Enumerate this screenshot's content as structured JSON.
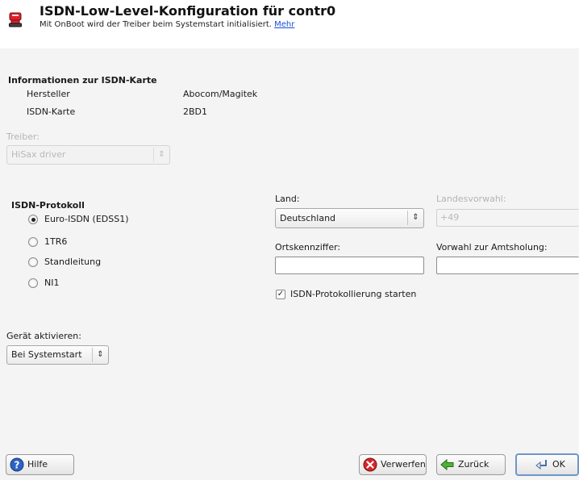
{
  "header": {
    "title": "ISDN-Low-Level-Konfiguration für contr0",
    "subtitle": "Mit OnBoot wird der Treiber beim Systemstart initialisiert.",
    "more_link": "Mehr",
    "icon": "isdn-card-icon"
  },
  "card_info": {
    "section_title": "Informationen zur ISDN-Karte",
    "manufacturer_label": "Hersteller",
    "manufacturer_value": "Abocom/Magitek",
    "card_label": "ISDN-Karte",
    "card_value": "2BD1"
  },
  "driver": {
    "label": "Treiber:",
    "selected": "HiSax driver",
    "enabled": false
  },
  "protocol": {
    "section_title": "ISDN-Protokoll",
    "options": [
      "Euro-ISDN (EDSS1)",
      "1TR6",
      "Standleitung",
      "NI1"
    ],
    "selected_index": 0
  },
  "country": {
    "label": "Land:",
    "selected": "Deutschland"
  },
  "area_code": {
    "label": "Landesvorwahl:",
    "value": "+49",
    "enabled": false
  },
  "local_prefix": {
    "label": "Ortskennziffer:",
    "value": ""
  },
  "dial_prefix": {
    "label": "Vorwahl zur Amtsholung:",
    "value": ""
  },
  "logging": {
    "label": "ISDN-Protokollierung starten",
    "checked": true
  },
  "activation": {
    "label": "Gerät aktivieren:",
    "selected": "Bei Systemstart"
  },
  "footer": {
    "help": "Hilfe",
    "discard": "Verwerfen",
    "back": "Zurück",
    "ok": "OK"
  },
  "colors": {
    "content_bg": "#f4f4f4",
    "link": "#1b4fd8",
    "default_button_border": "#6f96c8"
  }
}
